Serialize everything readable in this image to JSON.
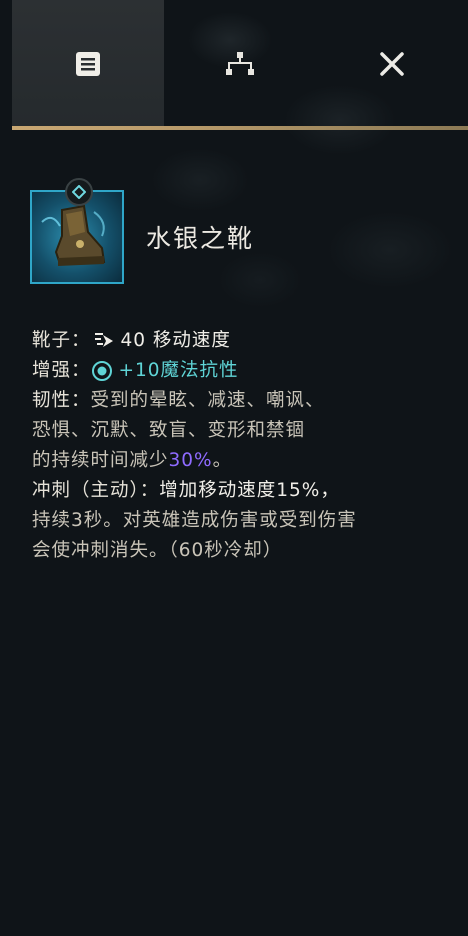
{
  "tabs": [
    {
      "icon": "list-icon",
      "active": true
    },
    {
      "icon": "build-tree-icon",
      "active": false
    },
    {
      "icon": "close-icon",
      "active": false
    }
  ],
  "item": {
    "name": "水银之靴",
    "icon": "boots-icon",
    "badge_icon": "tier-diamond-icon"
  },
  "stats": {
    "boots_label": "靴子：",
    "boots_value": "40 移动速度",
    "upgrade_label": "增强：",
    "upgrade_value": "+10魔法抗性"
  },
  "passive": {
    "label": "韧性：",
    "text_line1": "受到的晕眩、减速、嘲讽、",
    "text_line2": "恐惧、沉默、致盲、变形和禁锢",
    "text_line3_pre": "的持续时间减少",
    "text_line3_pct": "30%",
    "text_line3_post": "。"
  },
  "active": {
    "label": "冲刺（主动）：",
    "line1_rest": "增加移动速度15%，",
    "line2": "持续3秒。对英雄造成伤害或受到伤害",
    "line3": "会使冲刺消失。（60秒冷却）"
  },
  "colors": {
    "accent_gold": "#c9a873",
    "cyan": "#5fd4d6",
    "purple": "#8f6bff",
    "icon_border": "#2fa6c8"
  }
}
